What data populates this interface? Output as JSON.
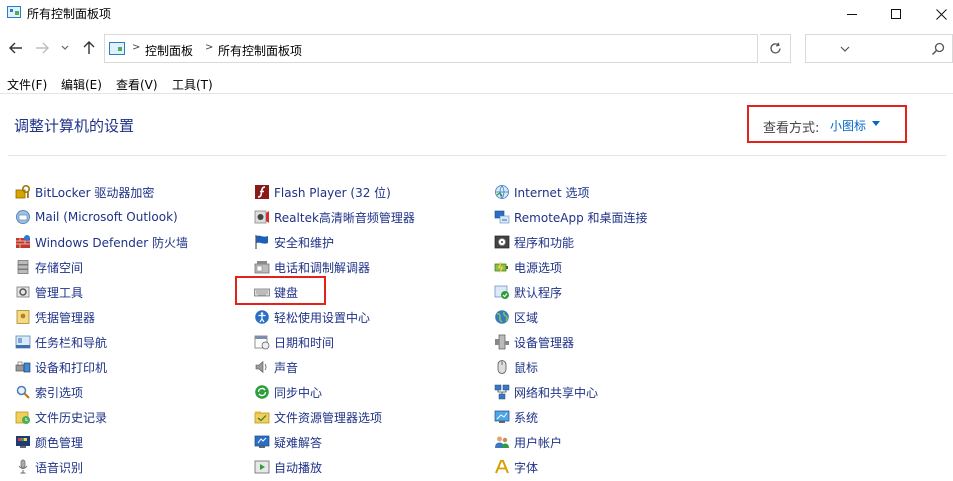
{
  "window": {
    "title": "所有控制面板项"
  },
  "address": {
    "crumbs": [
      "控制面板",
      "所有控制面板项"
    ],
    "search_placeholder": ""
  },
  "menu": [
    "文件(F)",
    "编辑(E)",
    "查看(V)",
    "工具(T)"
  ],
  "header": {
    "title": "调整计算机的设置",
    "view_by_label": "查看方式:",
    "view_by_value": "小图标"
  },
  "columns": [
    {
      "items": [
        {
          "label": "BitLocker 驱动器加密",
          "icon": "bitlocker-icon"
        },
        {
          "label": "Mail (Microsoft Outlook)",
          "icon": "mail-icon"
        },
        {
          "label": "Windows Defender 防火墙",
          "icon": "firewall-icon"
        },
        {
          "label": "存储空间",
          "icon": "storage-icon"
        },
        {
          "label": "管理工具",
          "icon": "admin-tools-icon"
        },
        {
          "label": "凭据管理器",
          "icon": "credential-icon"
        },
        {
          "label": "任务栏和导航",
          "icon": "taskbar-icon"
        },
        {
          "label": "设备和打印机",
          "icon": "printer-icon"
        },
        {
          "label": "索引选项",
          "icon": "index-icon"
        },
        {
          "label": "文件历史记录",
          "icon": "file-history-icon"
        },
        {
          "label": "颜色管理",
          "icon": "color-icon"
        },
        {
          "label": "语音识别",
          "icon": "microphone-icon"
        }
      ]
    },
    {
      "items": [
        {
          "label": "Flash Player (32 位)",
          "icon": "flash-icon"
        },
        {
          "label": "Realtek高清晰音频管理器",
          "icon": "realtek-icon"
        },
        {
          "label": "安全和维护",
          "icon": "flag-icon"
        },
        {
          "label": "电话和调制解调器",
          "icon": "phone-icon"
        },
        {
          "label": "键盘",
          "icon": "keyboard-icon"
        },
        {
          "label": "轻松使用设置中心",
          "icon": "ease-of-access-icon"
        },
        {
          "label": "日期和时间",
          "icon": "datetime-icon"
        },
        {
          "label": "声音",
          "icon": "speaker-icon"
        },
        {
          "label": "同步中心",
          "icon": "sync-icon"
        },
        {
          "label": "文件资源管理器选项",
          "icon": "folder-options-icon"
        },
        {
          "label": "疑难解答",
          "icon": "troubleshoot-icon"
        },
        {
          "label": "自动播放",
          "icon": "autoplay-icon"
        }
      ]
    },
    {
      "items": [
        {
          "label": "Internet 选项",
          "icon": "internet-icon"
        },
        {
          "label": "RemoteApp 和桌面连接",
          "icon": "remoteapp-icon"
        },
        {
          "label": "程序和功能",
          "icon": "programs-icon"
        },
        {
          "label": "电源选项",
          "icon": "power-icon"
        },
        {
          "label": "默认程序",
          "icon": "default-programs-icon"
        },
        {
          "label": "区域",
          "icon": "region-icon"
        },
        {
          "label": "设备管理器",
          "icon": "device-manager-icon"
        },
        {
          "label": "鼠标",
          "icon": "mouse-icon"
        },
        {
          "label": "网络和共享中心",
          "icon": "network-icon"
        },
        {
          "label": "系统",
          "icon": "system-icon"
        },
        {
          "label": "用户帐户",
          "icon": "users-icon"
        },
        {
          "label": "字体",
          "icon": "font-icon"
        }
      ]
    }
  ]
}
